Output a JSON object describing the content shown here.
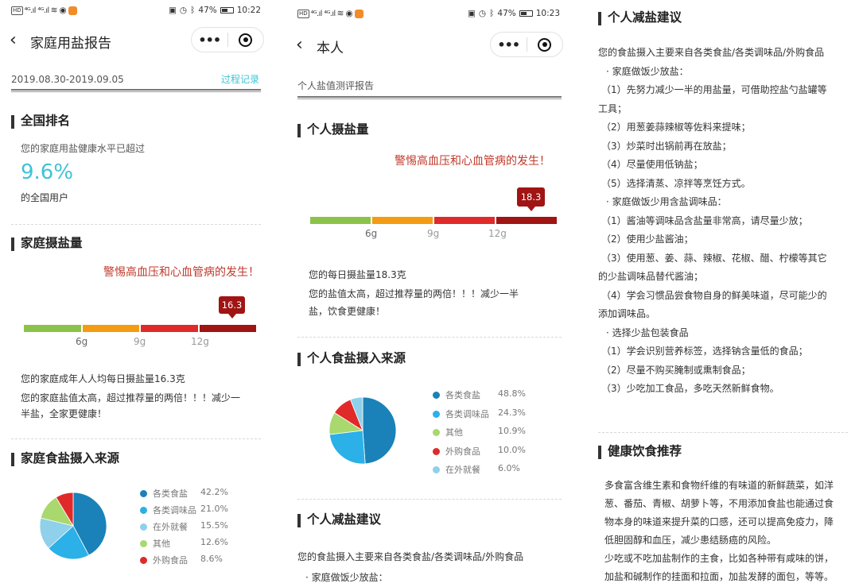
{
  "status": {
    "network": "HD",
    "signal": "⁴ᴳ.ıl ⁴ᴳ.ıl",
    "battery": "47%",
    "time_left": "10:22",
    "time_mid": "10:23"
  },
  "colors": {
    "accent": "#3ec3d6",
    "warn": "#c0392b",
    "badge": "#a01414",
    "scale": [
      "#8bc34a",
      "#f39c12",
      "#e02a2a",
      "#a01414"
    ]
  },
  "panel1": {
    "nav_title": "家庭用盐报告",
    "date_range": "2019.08.30-2019.09.05",
    "history_link": "过程记录",
    "rank_heading": "全国排名",
    "rank_text": "您的家庭用盐健康水平已超过",
    "rank_pct": "9.6%",
    "rank_suffix": "的全国用户",
    "intake_heading": "家庭摄盐量",
    "warning": "警惕高血压和心血管病的发生！",
    "badge_value": "16.3",
    "ticks": [
      "6g",
      "9g",
      "12g"
    ],
    "intake_line1": "您的家庭成年人人均每日摄盐量16.3克",
    "intake_line2": "您的家庭盐值太高，超过推荐量的两倍！！！减少一",
    "intake_line3": "半盐，全家更健康！",
    "source_heading": "家庭食盐摄入来源"
  },
  "panel2": {
    "nav_title": "本人",
    "subtitle": "个人盐值测评报告",
    "intake_heading": "个人摄盐量",
    "warning": "警惕高血压和心血管病的发生！",
    "badge_value": "18.3",
    "ticks": [
      "6g",
      "9g",
      "12g"
    ],
    "intake_line1": "您的每日摄盐量18.3克",
    "intake_line2": "您的盐值太高，超过推荐量的两倍！！！减少一半",
    "intake_line3": "盐，饮食更健康！",
    "source_heading": "个人食盐摄入来源",
    "advice_heading": "个人减盐建议",
    "advice_line1": "您的食盐摄入主要来自各类食盐/各类调味品/外购食品",
    "advice_line2": "· 家庭做饭少放盐："
  },
  "panel3": {
    "advice_heading": "个人减盐建议",
    "advice_lines": [
      "您的食盐摄入主要来自各类食盐/各类调味品/外购食品",
      "· 家庭做饭少放盐：",
      "（1）先努力减少一半的用盐量，可借助控盐勺盐罐等",
      "工具；",
      "（2）用葱姜蒜辣椒等佐料来提味；",
      "（3）炒菜时出锅前再在放盐；",
      "（4）尽量使用低钠盐；",
      "（5）选择清蒸、凉拌等烹饪方式。",
      "· 家庭做饭少用含盐调味品：",
      "（1）酱油等调味品含盐量非常高，请尽量少放；",
      "（2）使用少盐酱油；",
      "（3）使用葱、姜、蒜、辣椒、花椒、醋、柠檬等其它",
      "的少盐调味品替代酱油；",
      "（4）学会习惯品尝食物自身的鲜美味道，尽可能少的",
      "添加调味品。",
      "· 选择少盐包装食品",
      "（1）学会识别营养标签，选择钠含量低的食品；",
      "（2）尽量不购买腌制或熏制食品；",
      "（3）少吃加工食品，多吃天然新鲜食物。"
    ],
    "diet_heading": "健康饮食推荐",
    "diet_lines": [
      "多食富含维生素和食物纤维的有味道的新鲜蔬菜，如洋",
      "葱、番茄、青椒、胡萝卜等，不用添加食盐也能通过食",
      "物本身的味道来提升菜的口感，还可以提高免疫力，降",
      "低胆固醇和血压，减少患结肠癌的风险。",
      "少吃或不吃加盐制作的主食，比如各种带有咸味的饼，",
      "加盐和碱制作的挂面和拉面，加盐发酵的面包，等等。"
    ]
  },
  "chart_data": [
    {
      "type": "pie",
      "title": "家庭食盐摄入来源",
      "categories": [
        "各类食盐",
        "各类调味品",
        "在外就餐",
        "其他",
        "外购食品"
      ],
      "values": [
        42.2,
        21.0,
        15.5,
        12.6,
        8.6
      ],
      "labels": [
        "42.2%",
        "21.0%",
        "15.5%",
        "12.6%",
        "8.6%"
      ],
      "colors": [
        "#1a82b8",
        "#2bb0e8",
        "#8fd0ea",
        "#a9d86e",
        "#e02a2a"
      ]
    },
    {
      "type": "pie",
      "title": "个人食盐摄入来源",
      "categories": [
        "各类食盐",
        "各类调味品",
        "其他",
        "外购食品",
        "在外就餐"
      ],
      "values": [
        48.8,
        24.3,
        10.9,
        10.0,
        6.0
      ],
      "labels": [
        "48.8%",
        "24.3%",
        "10.9%",
        "10.0%",
        "6.0%"
      ],
      "colors": [
        "#1a82b8",
        "#2bb0e8",
        "#a9d86e",
        "#e02a2a",
        "#8fd0ea"
      ]
    }
  ]
}
